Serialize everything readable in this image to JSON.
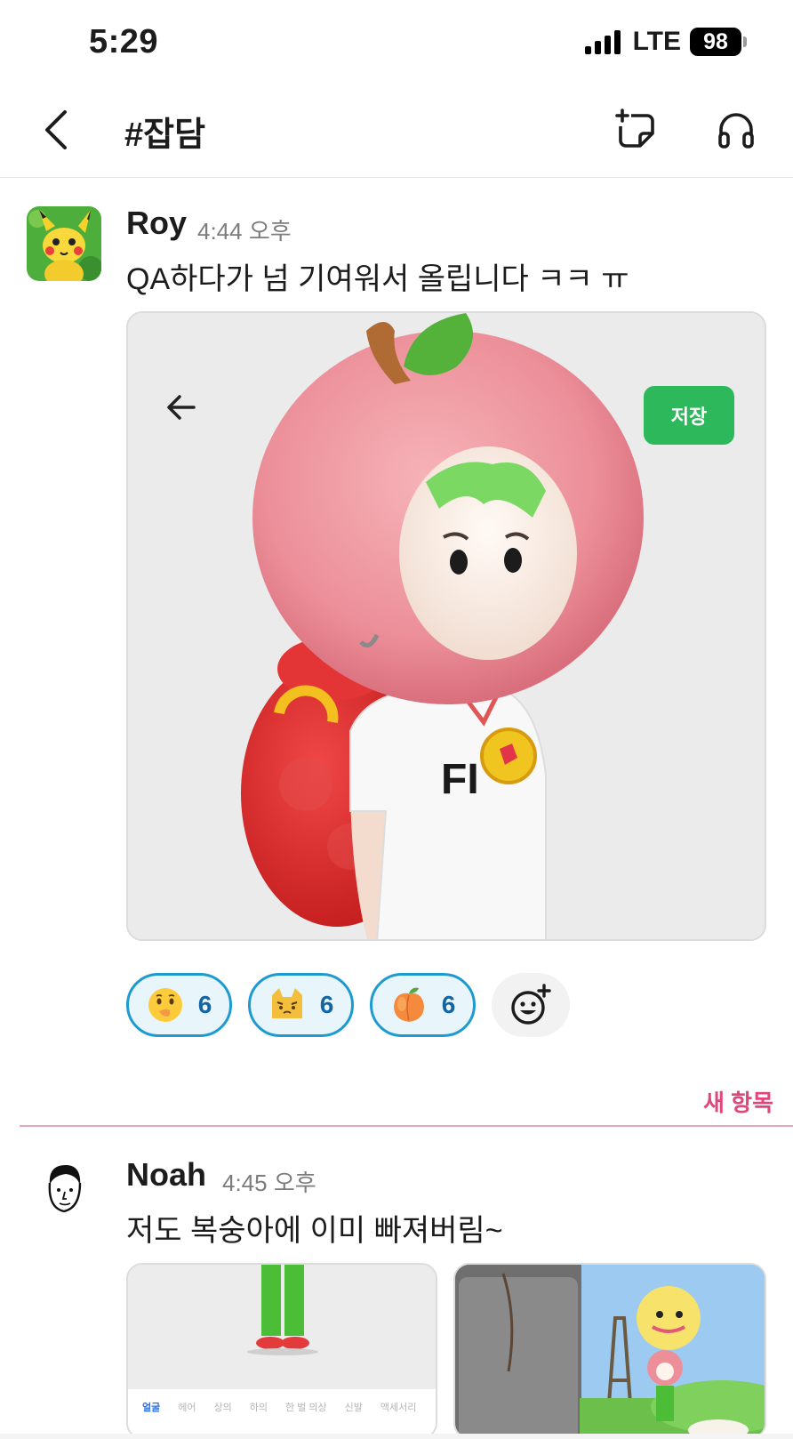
{
  "status_bar": {
    "time": "5:29",
    "network": "LTE",
    "battery": "98"
  },
  "header": {
    "channel": "#잡담"
  },
  "messages": [
    {
      "author": "Roy",
      "time": "4:44 오후",
      "text": "QA하다가 넘 기여워서 올립니다 ㅋㅋ ㅠ",
      "image": {
        "save_label": "저장",
        "shirt_text": "FI"
      },
      "reactions": [
        {
          "icon": "shushing-face-emoji",
          "count": "6"
        },
        {
          "icon": "cat-face-emoji",
          "count": "6"
        },
        {
          "icon": "peach-emoji",
          "count": "6"
        }
      ]
    },
    {
      "author": "Noah",
      "time": "4:45 오후",
      "text": "저도 복숭아에 이미 빠져버림~",
      "thumb_tabs": [
        "얼굴",
        "헤어",
        "상의",
        "하의",
        "한 벌 의상",
        "신발",
        "액세서리"
      ]
    }
  ],
  "divider": {
    "label": "새 항목"
  },
  "colors": {
    "accent": "#1d9bd1",
    "new_divider": "#e0457b",
    "save": "#2eb85c"
  }
}
